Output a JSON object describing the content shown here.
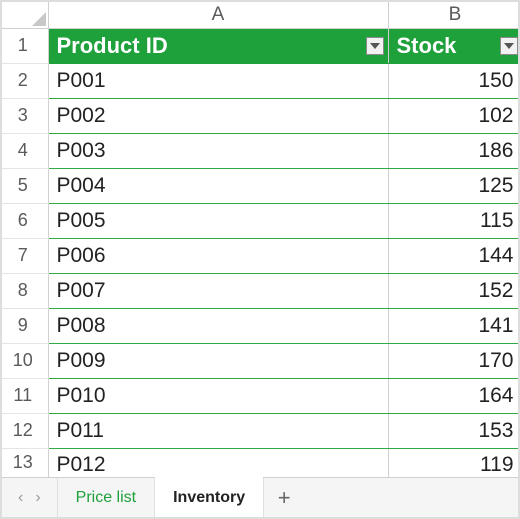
{
  "colors": {
    "tableHeader": "#1ea03b",
    "rowBorder": "#31a945"
  },
  "columns": {
    "A": "A",
    "B": "B"
  },
  "header": {
    "productId": "Product ID",
    "stock": "Stock"
  },
  "rows": [
    {
      "n": "1"
    },
    {
      "n": "2",
      "id": "P001",
      "stock": "150"
    },
    {
      "n": "3",
      "id": "P002",
      "stock": "102"
    },
    {
      "n": "4",
      "id": "P003",
      "stock": "186"
    },
    {
      "n": "5",
      "id": "P004",
      "stock": "125"
    },
    {
      "n": "6",
      "id": "P005",
      "stock": "115"
    },
    {
      "n": "7",
      "id": "P006",
      "stock": "144"
    },
    {
      "n": "8",
      "id": "P007",
      "stock": "152"
    },
    {
      "n": "9",
      "id": "P008",
      "stock": "141"
    },
    {
      "n": "10",
      "id": "P009",
      "stock": "170"
    },
    {
      "n": "11",
      "id": "P010",
      "stock": "164"
    },
    {
      "n": "12",
      "id": "P011",
      "stock": "153"
    },
    {
      "n": "13",
      "id": "P012",
      "stock": "119"
    }
  ],
  "tabs": {
    "priceList": "Price list",
    "inventory": "Inventory",
    "add": "+"
  },
  "nav": {
    "prev": "‹",
    "next": "›"
  }
}
